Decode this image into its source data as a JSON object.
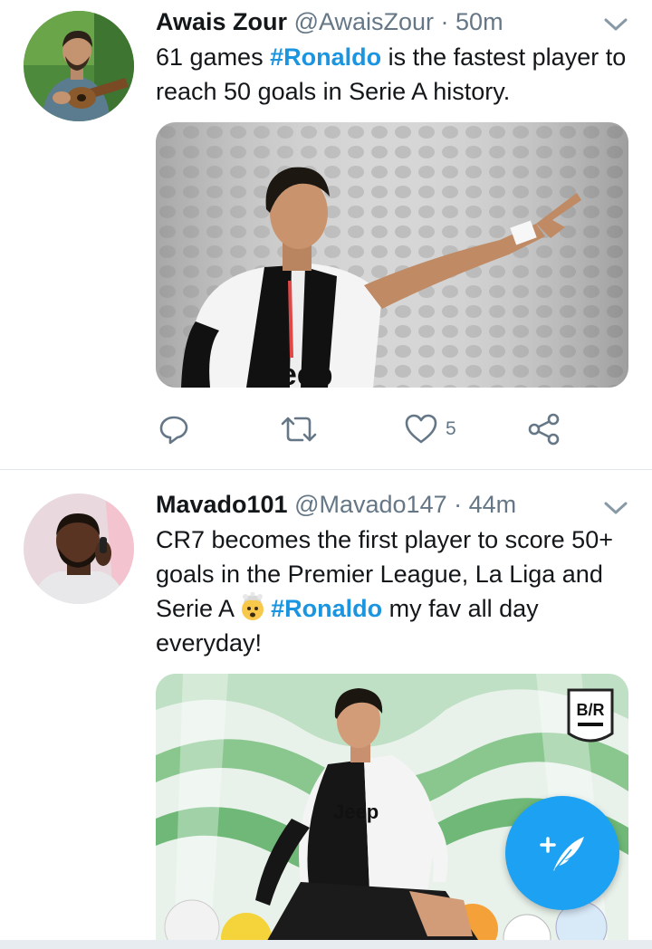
{
  "tweets": [
    {
      "display_name": "Awais Zour",
      "handle": "@AwaisZour",
      "separator": " · ",
      "time": "50m",
      "text_before": "61 games ",
      "hashtag": "#Ronaldo",
      "text_after": " is the fastest player to reach 50 goals in Serie A history.",
      "image_desc": "Ronaldo pointing in Juventus kit",
      "image_text": "Jeep",
      "actions": {
        "reply_icon": "reply-icon",
        "retweet_icon": "retweet-icon",
        "like_icon": "heart-icon",
        "like_count": "5",
        "share_icon": "share-icon"
      }
    },
    {
      "display_name": "Mavado101",
      "handle": "@Mavado147",
      "separator": " · ",
      "time": "44m",
      "text_before": "CR7 becomes the first player to score 50+ goals in the Premier League, La Liga and Serie A",
      "emoji": "exploding-head-emoji",
      "hashtag": "#Ronaldo",
      "text_after": " my fav all day everyday!",
      "image_text": "Jeep",
      "image_logo": "B/R"
    }
  ],
  "compose_button": {
    "icon": "compose-feather-icon",
    "label": "+"
  },
  "colors": {
    "link": "#1b95e0",
    "fab": "#1da1f2",
    "muted": "#657786",
    "divider": "#e1e8ed"
  }
}
